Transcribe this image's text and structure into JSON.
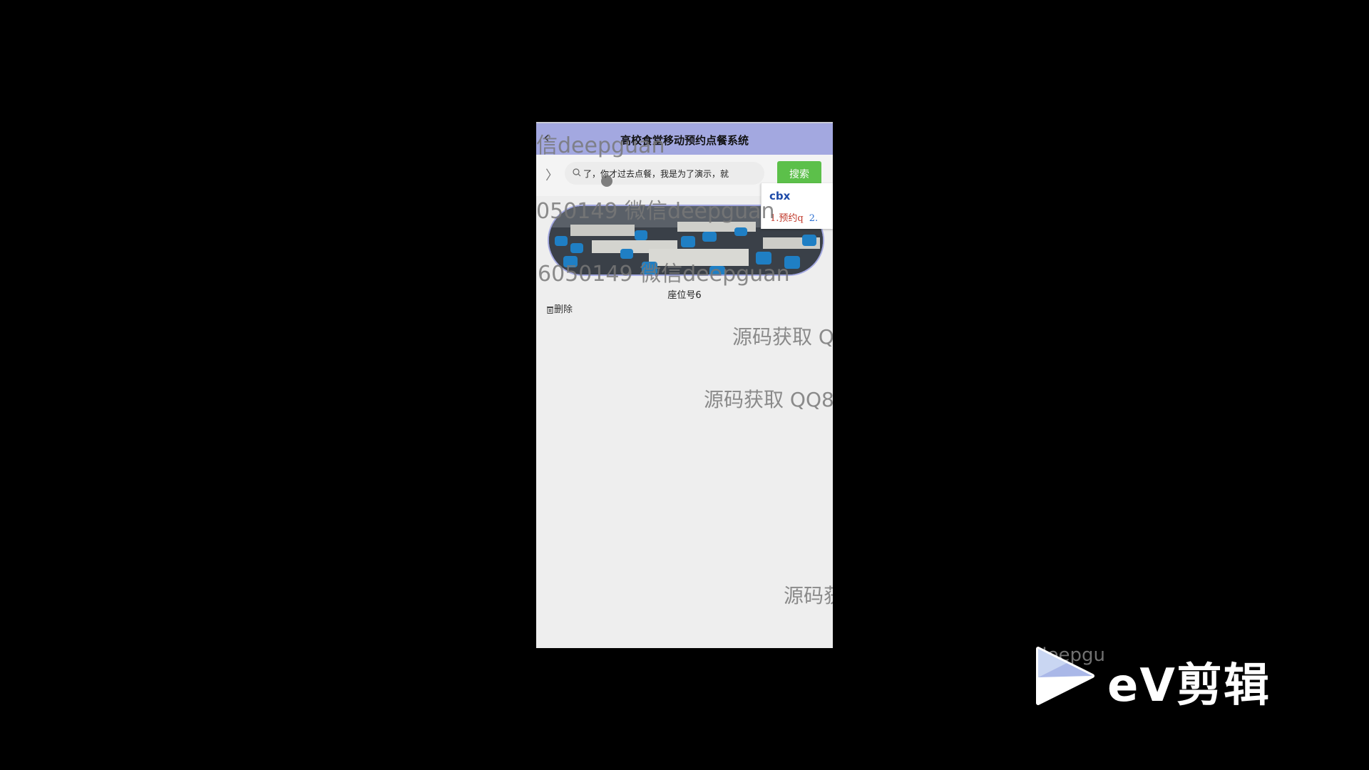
{
  "header": {
    "back_icon": "left-arrow-icon",
    "title": "高校食堂移动预约点餐系统"
  },
  "search": {
    "value": "了，你才过去点餐，我是为了演示，就",
    "button_label": "搜索"
  },
  "ime": {
    "input": "cbx",
    "candidates": [
      "1.预约q",
      "2."
    ]
  },
  "item": {
    "seat_label": "座位号6",
    "delete_label": "删除"
  },
  "watermarks": {
    "w1": "信deepguan",
    "w2": "050149 微信deepguan",
    "w3": "6050149 微信deepguan",
    "w4": "源码获取 Q",
    "w5": "源码获取 QQ8",
    "w6": "源码获",
    "w7": "deepgu"
  },
  "app_logo": {
    "text": "eV剪辑"
  }
}
